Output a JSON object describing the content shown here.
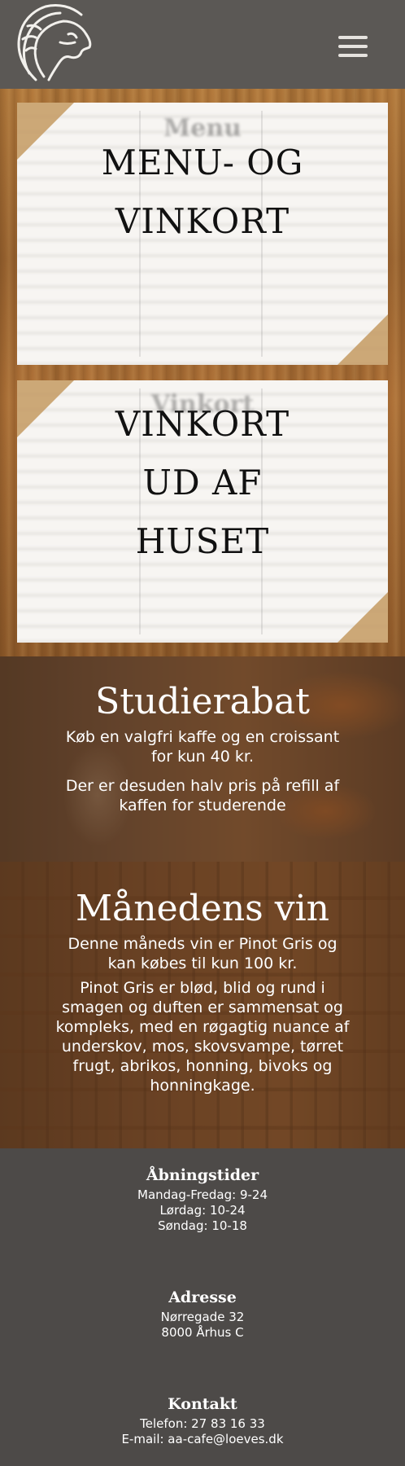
{
  "header": {
    "logo_icon": "lion-head-icon",
    "menu_icon": "hamburger-menu-icon"
  },
  "cards": [
    {
      "label_lines": [
        "MENU- OG",
        "VINKORT"
      ],
      "bg_title": "Menu"
    },
    {
      "label_lines": [
        "VINKORT",
        "UD AF",
        "HUSET"
      ],
      "bg_title": "Vinkort"
    }
  ],
  "student": {
    "title": "Studierabat",
    "text1": "Køb en valgfri kaffe og en croissant for kun 40 kr.",
    "text2": "Der er desuden halv pris på refill af kaffen for studerende"
  },
  "wine": {
    "title": "Månedens vin",
    "text1": "Denne måneds vin er Pinot Gris og kan købes til kun 100 kr.",
    "text2": "Pinot Gris er blød, blid og rund i smagen og duften er sammensat og kompleks, med en røgagtig nuance af underskov, mos, skovsvampe, tørret frugt, abrikos, honning, bivoks og honningkage."
  },
  "footer": {
    "hours": {
      "title": "Åbningstider",
      "lines": [
        "Mandag-Fredag: 9-24",
        "Lørdag: 10-24",
        "Søndag: 10-18"
      ]
    },
    "address": {
      "title": "Adresse",
      "lines": [
        "Nørregade 32",
        "8000 Århus C"
      ]
    },
    "contact": {
      "title": "Kontakt",
      "lines": [
        "Telefon: 27 83 16 33",
        "E-mail: aa-cafe@loeves.dk"
      ]
    }
  },
  "colors": {
    "header_bg": "#5b5855",
    "footer_bg": "#4d4a48",
    "wood": "#a06a34",
    "photo_tint": "#784b28"
  }
}
